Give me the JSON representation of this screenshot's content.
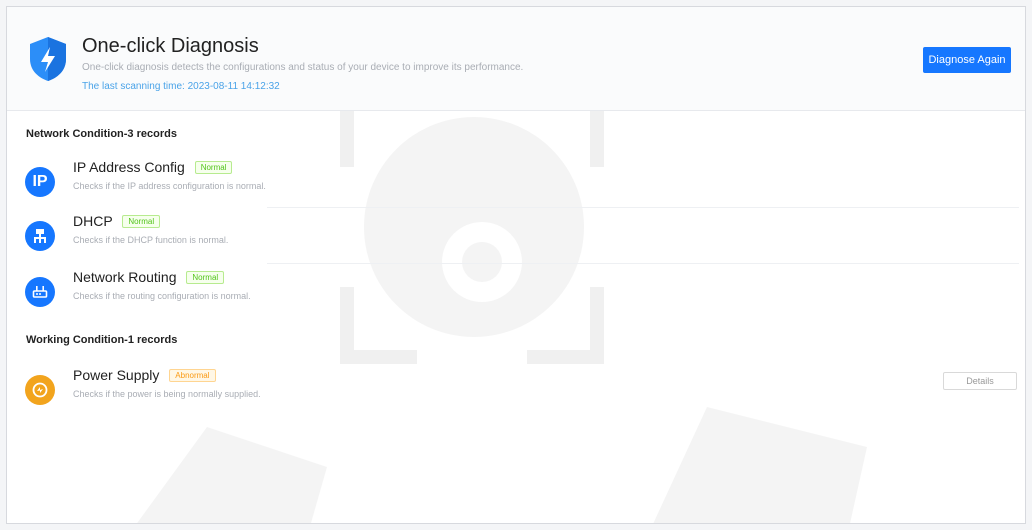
{
  "header": {
    "title": "One-click Diagnosis",
    "subtitle": "One-click diagnosis detects the configurations and status of your device to improve its performance.",
    "scan_time": "The last scanning time: 2023-08-11 14:12:32",
    "diagnose_label": "Diagnose Again"
  },
  "sections": [
    {
      "title": "Network Condition-3 records",
      "items": [
        {
          "name": "IP Address Config",
          "status": "Normal",
          "desc": "Checks if the IP address configuration is normal.",
          "icon": "ip-icon"
        },
        {
          "name": "DHCP",
          "status": "Normal",
          "desc": "Checks if the DHCP function is normal.",
          "icon": "network-icon"
        },
        {
          "name": "Network Routing",
          "status": "Normal",
          "desc": "Checks if the routing configuration is normal.",
          "icon": "router-icon"
        }
      ]
    },
    {
      "title": "Working Condition-1 records",
      "items": [
        {
          "name": "Power Supply",
          "status": "Abnormal",
          "desc": "Checks if the power is being normally supplied.",
          "icon": "power-icon",
          "action": "Details"
        }
      ]
    }
  ],
  "colors": {
    "accent": "#1677ff",
    "icon_blue": "#1677ff",
    "icon_warning": "#faa21b",
    "normal": "#52c41a",
    "abnormal": "#fa9a14"
  }
}
